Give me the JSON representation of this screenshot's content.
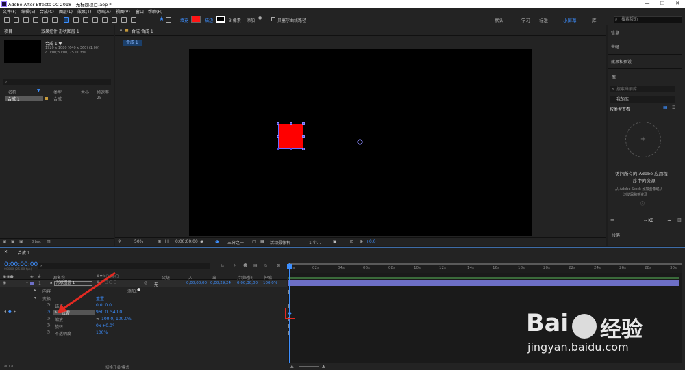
{
  "app": {
    "title": "Adobe After Effects CC 2018 - 无标题项目.aep *"
  },
  "menu": [
    "文件(F)",
    "编辑(E)",
    "合成(C)",
    "图层(L)",
    "效果(T)",
    "动画(A)",
    "视图(V)",
    "窗口",
    "帮助(H)"
  ],
  "toolbar": {
    "fill_label": "填充",
    "stroke_label": "描边",
    "stroke_size": "3 像素",
    "add_label": "添加",
    "bezier_label": "贝塞尔曲线路径",
    "workspaces": [
      "默认",
      "学习",
      "标准",
      "小屏幕",
      "库"
    ],
    "search_placeholder": "搜索帮助"
  },
  "project": {
    "tab": "项目",
    "tab2": "效果控件 形状图层 1",
    "comp_name": "合成 1 ▼",
    "comp_info1": "1920 x 1080 (640 x 360) (1.00)",
    "comp_info2": "Δ 0;00;30;00, 25.00 fps",
    "col_name": "名称",
    "col_type": "类型",
    "col_size": "大小",
    "col_fps": "帧速率",
    "item_name": "合成 1",
    "item_type": "合成",
    "item_fps": "25",
    "bpc": "8 bpc"
  },
  "viewer": {
    "tab": "合成 合成 1",
    "subtab": "合成 1",
    "zoom": "50%",
    "timecode": "0;00;00;00",
    "resolution": "三分之一",
    "camera": "活动摄像机",
    "views": "1 个...",
    "exposure": "+0.0"
  },
  "right": {
    "items": [
      "信息",
      "音频",
      "效果和预设"
    ],
    "library_title": "库",
    "lib_search": "搜索当前库",
    "my_lib": "我的库",
    "view_by": "按类型查看",
    "lib_msg1": "访问所有的 Adobe 应用程",
    "lib_msg2": "序中的资源",
    "stock1": "从 Adobe Stock 添加图像或从",
    "stock2": "浏览器和将资源一",
    "kb": "-- KB",
    "tracker": "段落"
  },
  "timeline": {
    "tab": "合成 1",
    "time": "0:00:00:00",
    "frame": "00000 (25.00 fps)",
    "col_source": "源名称",
    "col_parent": "父级",
    "col_in": "入",
    "col_out": "出",
    "col_dur": "持续时间",
    "col_stretch": "伸缩",
    "layer_num": "1",
    "layer_name": "形状图层 1",
    "layer_parent": "无",
    "layer_in": "0;00;00;00",
    "layer_out": "0;00;29;24",
    "layer_dur": "0;00;30;00",
    "layer_stretch": "100.0%",
    "content": "内容",
    "add": "添加:",
    "transform": "变换",
    "reset": "重置",
    "props": [
      {
        "name": "锚点",
        "value": "0.0, 0.0"
      },
      {
        "name": "位置",
        "value": "960.0, 540.0"
      },
      {
        "name": "缩放",
        "value": "100.0, 100.0%"
      },
      {
        "name": "旋转",
        "value": "0x +0.0°"
      },
      {
        "name": "不透明度",
        "value": "100%"
      }
    ],
    "ruler": [
      "0s",
      "02s",
      "04s",
      "06s",
      "08s",
      "10s",
      "12s",
      "14s",
      "16s",
      "18s",
      "20s",
      "22s",
      "24s",
      "26s",
      "28s",
      "30s"
    ],
    "toggle_label": "切换开关/模式"
  },
  "watermark": {
    "brand": "Bai",
    "brand2": "经验",
    "url": "jingyan.baidu.com"
  },
  "colors": {
    "accent": "#3d8fff",
    "fill": "#ff0000",
    "layer_bar": "#6d6fc6",
    "highlight": "#e42a22"
  }
}
